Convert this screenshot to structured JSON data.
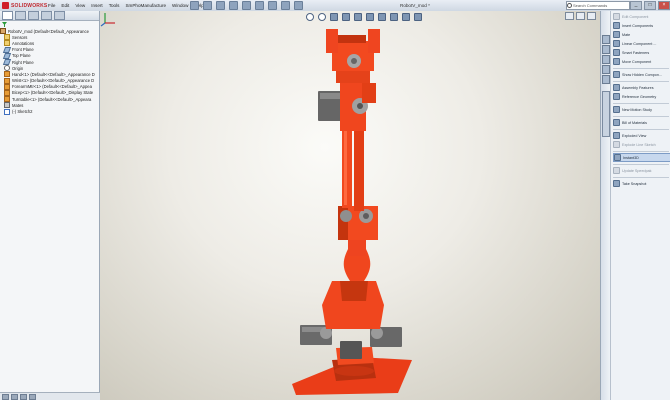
{
  "app": {
    "brand": "SOLIDWORKS",
    "doc_title": "RobotV_mod *"
  },
  "menu": [
    "File",
    "Edit",
    "View",
    "Insert",
    "Tools",
    "SmPhoManufacture",
    "Window",
    "Help"
  ],
  "search": {
    "placeholder": "Search Commands"
  },
  "window_controls": {
    "minimize": "_",
    "maximize": "□",
    "close": "×"
  },
  "feature_tree": {
    "items": [
      {
        "label": "RobotV_mod  (Default<Default_Appearance",
        "icon": "assembly-icon"
      },
      {
        "label": "Sensors",
        "icon": "sensor-icon"
      },
      {
        "label": "Annotations",
        "icon": "annotation-icon"
      },
      {
        "label": "Front Plane",
        "icon": "plane-icon"
      },
      {
        "label": "Top Plane",
        "icon": "plane-icon"
      },
      {
        "label": "Right Plane",
        "icon": "plane-icon"
      },
      {
        "label": "Origin",
        "icon": "origin-icon"
      },
      {
        "label": "Hand<1> (Default<<Default>_Appearance D",
        "icon": "part-icon"
      },
      {
        "label": "Wrist<1> (Default<<Default>_Appearance D",
        "icon": "part-icon"
      },
      {
        "label": "ForearmMtr<1> (Default<<Default>_Appea",
        "icon": "part-icon"
      },
      {
        "label": "Bicep<1> (Default<<Default>_Display State",
        "icon": "part-icon"
      },
      {
        "label": "Turntable<1> (Default<<Default>_Appeara",
        "icon": "part-icon"
      },
      {
        "label": "Mates",
        "icon": "mates-icon"
      },
      {
        "label": "(-) Sketch2",
        "icon": "sketch-icon"
      }
    ]
  },
  "command_panel": {
    "items": [
      {
        "label": "Edit Component",
        "dim": true
      },
      {
        "label": "Insert Components",
        "arrow": true
      },
      {
        "label": "Mate"
      },
      {
        "label": "Linear Component ...",
        "arrow": true
      },
      {
        "label": "Smart Fasteners"
      },
      {
        "label": "Move Component",
        "arrow": true
      },
      {
        "label": "Show Hidden Compon..."
      },
      {
        "label": "Assembly Features",
        "arrow": true
      },
      {
        "label": "Reference Geometry",
        "arrow": true
      },
      {
        "label": "New Motion Study"
      },
      {
        "label": "Bill of Materials"
      },
      {
        "label": "Exploded View"
      },
      {
        "label": "Explode Line Sketch",
        "dim": true
      },
      {
        "label": "Instant3D",
        "selected": true
      },
      {
        "label": "Update Speedpak",
        "dim": true
      },
      {
        "label": "Take Snapshot"
      }
    ]
  },
  "colors": {
    "robot": "#f0461e",
    "robot_dark": "#b52e10",
    "servo": "#6f6f6f",
    "accent": "#2f6bbf"
  }
}
